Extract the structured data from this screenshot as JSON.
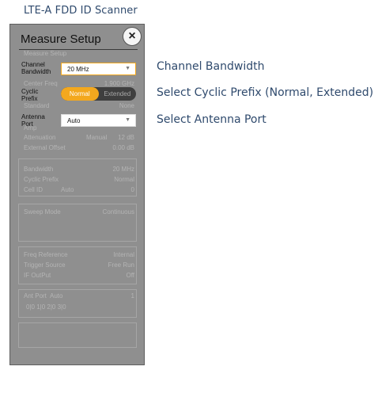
{
  "page_title": "LTE-A FDD ID Scanner",
  "panel": {
    "title": "Measure Setup",
    "close_icon": "×",
    "faded_top": "Measure Setup",
    "channel_bandwidth": {
      "label": "Channel Bandwidth",
      "value": "20 MHz",
      "caret": "▼"
    },
    "faded_center_freq": {
      "label": "Center Freq",
      "value": "1.900 GHz"
    },
    "cyclic_prefix": {
      "label": "Cyclic Prefix",
      "options": [
        "Normal",
        "Extended"
      ],
      "selected": "Normal"
    },
    "faded_standard": {
      "label": "Standard",
      "value": "None"
    },
    "antenna_port": {
      "label": "Antenna Port",
      "value": "Auto",
      "caret": "▼"
    },
    "faded_amp": {
      "label": "Amp"
    },
    "faded_attenuation": {
      "label": "Attenuation",
      "mode": "Manual",
      "value": "12 dB"
    },
    "faded_external_offset": {
      "label": "External Offset",
      "value": "0.00 dB"
    },
    "faded_bandwidth": {
      "label": "Bandwidth",
      "value": "20 MHz"
    },
    "faded_cyclic_prefix": {
      "label": "Cyclic Prefix",
      "value": "Normal"
    },
    "faded_cell_id": {
      "label": "Cell ID",
      "mode": "Auto",
      "value": "0"
    },
    "faded_sweep_mode": {
      "label": "Sweep Mode",
      "value": "Continuous"
    },
    "faded_freq_reference": {
      "label": "Freq Reference",
      "value": "Internal"
    },
    "faded_trigger_source": {
      "label": "Trigger Source",
      "value": "Free Run"
    },
    "faded_if_output": {
      "label": "IF OutPut",
      "value": "Off"
    },
    "faded_ant_port": {
      "label": "Ant Port",
      "mode": "Auto",
      "value": "1"
    },
    "faded_ports": "0|0  1|0  2|0  3|0"
  },
  "callouts": {
    "bandwidth": "Channel Bandwidth",
    "cyclic_prefix": "Select Cyclic Prefix (Normal, Extended)",
    "antenna_port": "Select Antenna Port"
  },
  "colors": {
    "accent": "#f3a81e",
    "panel_bg": "#8f8f8f",
    "callout_text": "#2f4a6d"
  }
}
